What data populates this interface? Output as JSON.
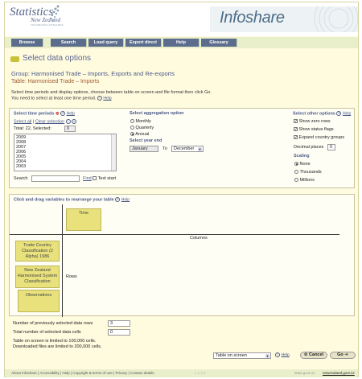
{
  "header": {
    "logo_text": "Statistics",
    "logo_country": "New Zealand",
    "logo_tagline": "TATAURANGA AOTEAROA",
    "brand": "Infoshare"
  },
  "nav": [
    "Browse",
    "Search",
    "Load query",
    "Export direct",
    "Help",
    "Glossary"
  ],
  "page_title": "Select data options",
  "group_label": "Group: Harmonised Trade – Imports, Exports and Re-exports",
  "table_label": "Table: Harmonised Trade – Imports",
  "instructions_1": "Select time periods and display options, choose between table on screen and file format then click Go.",
  "instructions_2": "You need to select at least one time period.",
  "help": "Help",
  "time_periods": {
    "title": "Select time periods",
    "select_all": "Select all",
    "clear": "Clear selection",
    "total_label": "Total: 22, Selected:",
    "selected": "0",
    "years": [
      "2009",
      "2008",
      "2007",
      "2006",
      "2005",
      "2004",
      "2003"
    ],
    "search_label": "Search",
    "find": "Find",
    "text_start": "Text start"
  },
  "aggregation": {
    "title": "Select aggregation option",
    "options": [
      "Monthly",
      "Quarterly",
      "Annual"
    ],
    "selected": "Annual",
    "year_end_title": "Select year end",
    "from": "January",
    "to_label": "To",
    "to": "December"
  },
  "other_options": {
    "title": "Select other options",
    "show_zero_rows": "Show zero rows",
    "show_status_flags": "Show status flags",
    "expand_country_groups": "Expand country groups",
    "decimal_places_label": "Decimal places",
    "decimal_places": "0",
    "scaling_title": "Scaling",
    "scaling_options": [
      "None",
      "Thousands",
      "Millions"
    ],
    "scaling_selected": "None"
  },
  "rearrange": {
    "title": "Click and drag variables to rearrange your table",
    "time": "Time",
    "columns": "Columns",
    "rows": "Rows",
    "var1": "Trade Country Classification (2 Alpha) 1986",
    "var2": "New Zealand Harmonised System Classification",
    "var3": "Observations"
  },
  "stats": {
    "prev_rows_label": "Number of previously selected data rows",
    "prev_rows": "3",
    "cells_label": "Total number of selected data cells",
    "cells": "0",
    "limit1": "Table on screen is limited to 100,000 cells.",
    "limit2": "Downloaded files are limited to 200,000 cells."
  },
  "output": {
    "format": "Table on screen",
    "cancel": "Cancel",
    "go": "Go"
  },
  "footer": {
    "links": "About Infoshare | Accessibility | Help | Copyright & terms of use | Privacy | Contact details",
    "version": "v 1.4.0",
    "domain": "stats.govt.nz",
    "nz_site": "newzealand.govt.nz"
  }
}
